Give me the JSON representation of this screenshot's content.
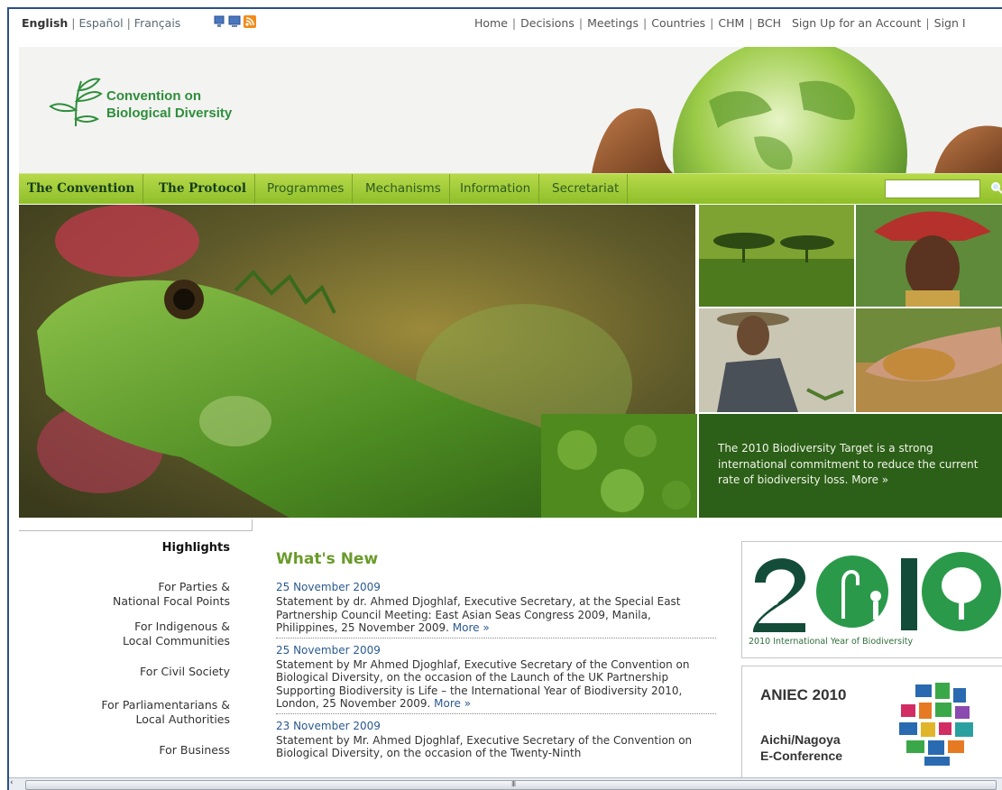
{
  "topbar": {
    "languages": [
      "English",
      "Español",
      "Français"
    ],
    "icons": [
      "desktop-icon",
      "monitor-icon",
      "rss-icon"
    ],
    "links": [
      "Home",
      "Decisions",
      "Meetings",
      "Countries",
      "CHM",
      "BCH",
      "Sign Up for an Account",
      "Sign I"
    ]
  },
  "header": {
    "logo_line1": "Convention on",
    "logo_line2": "Biological Diversity",
    "brand_color": "#2f8e3b"
  },
  "nav": {
    "items": [
      "The Convention",
      "The Protocol",
      "Programmes",
      "Mechanisms",
      "Information",
      "Secretariat"
    ],
    "search_icon": "magnifier-icon"
  },
  "hero": {
    "target_text": "The 2010 Biodiversity Target is a strong international commitment to reduce the current rate of biodiversity loss. More »"
  },
  "highlights": {
    "title": "Highlights",
    "items": [
      [
        "For Parties &",
        "National Focal Points"
      ],
      [
        "For Indigenous &",
        "Local Communities"
      ],
      [
        "For Civil Society"
      ],
      [
        "For Parliamentarians &",
        "Local Authorities"
      ],
      [
        "For Business"
      ]
    ]
  },
  "whats_new": {
    "title": "What's New",
    "items": [
      {
        "date": "25 November 2009",
        "text": "Statement by dr. Ahmed Djoghlaf, Executive Secretary, at the Special East Partnership Council Meeting: East Asian Seas Congress 2009, Manila, Philippines, 25 November 2009.",
        "more": "More »"
      },
      {
        "date": "25 November 2009",
        "text": "Statement by Mr Ahmed Djoghlaf, Executive Secretary of the Convention on Biological Diversity, on the occasion of the Launch of the UK Partnership Supporting Biodiversity is Life – the International Year of Biodiversity 2010, London, 25 November 2009.",
        "more": "More »"
      },
      {
        "date": "23 November 2009",
        "text": "Statement by Mr. Ahmed Djoghlaf, Executive Secretary of the Convention on Biological Diversity, on the occasion of the Twenty-Ninth",
        "more": ""
      }
    ]
  },
  "ads": {
    "iyb_caption": "2010 International Year of Biodiversity",
    "aniec_title": "ANIEC 2010",
    "aniec_sub1": "Aichi/Nagoya",
    "aniec_sub2": "E-Conference"
  },
  "scrollbar": {
    "grip": "III",
    "left_arrow": "‹"
  }
}
